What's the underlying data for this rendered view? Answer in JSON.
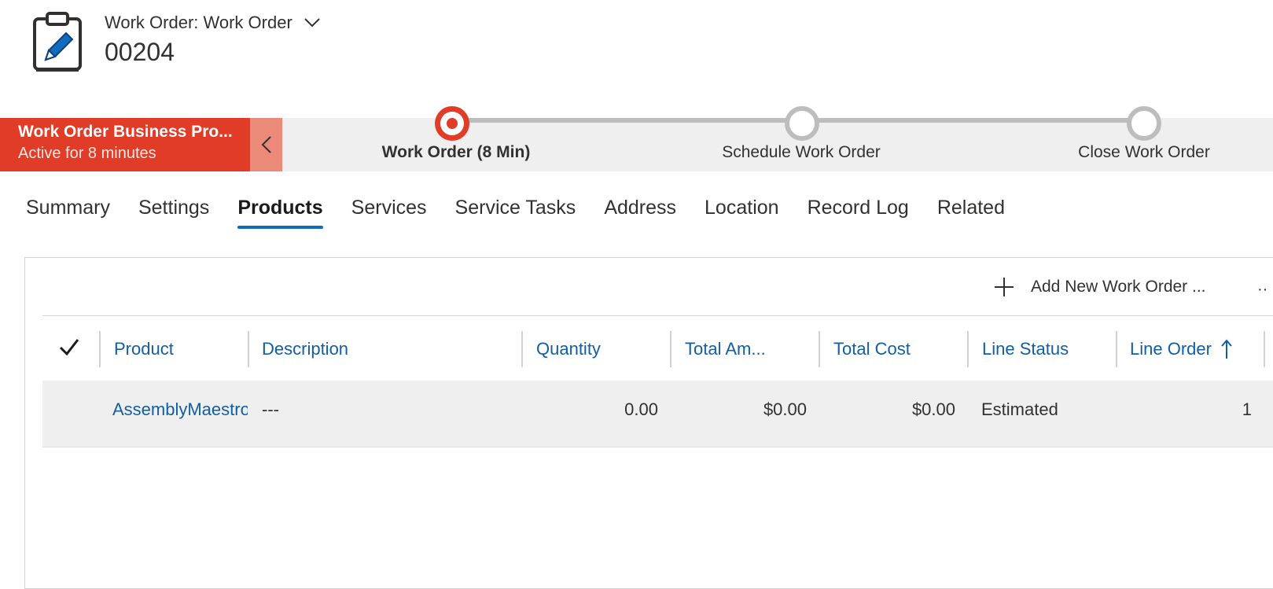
{
  "header": {
    "entity_label": "Work Order: Work Order",
    "record_title": "00204",
    "icon": "clipboard-pencil-icon"
  },
  "bpf": {
    "process_name": "Work Order Business Pro...",
    "active_for": "Active for 8 minutes",
    "collapse_icon": "chevron-left-icon",
    "stages": [
      {
        "label": "Work Order  (8 Min)",
        "state": "active"
      },
      {
        "label": "Schedule Work Order",
        "state": "inactive"
      },
      {
        "label": "Close Work Order",
        "state": "inactive"
      }
    ],
    "accent_color": "#e03c28"
  },
  "tabs": [
    {
      "label": "Summary"
    },
    {
      "label": "Settings"
    },
    {
      "label": "Products",
      "selected": true
    },
    {
      "label": "Services"
    },
    {
      "label": "Service Tasks"
    },
    {
      "label": "Address"
    },
    {
      "label": "Location"
    },
    {
      "label": "Record Log"
    },
    {
      "label": "Related"
    }
  ],
  "grid": {
    "command_add_label": "Add New Work Order ...",
    "more_label": "··",
    "columns": [
      "Product",
      "Description",
      "Quantity",
      "Total Am...",
      "Total Cost",
      "Line Status",
      "Line Order"
    ],
    "sort_column": "Line Order",
    "sort_direction": "ascending",
    "rows": [
      {
        "product": "AssemblyMaestro",
        "description": "---",
        "quantity": "0.00",
        "total_amount": "$0.00",
        "total_cost": "$0.00",
        "line_status": "Estimated",
        "line_order": "1"
      }
    ],
    "link_color": "#115ea3"
  }
}
